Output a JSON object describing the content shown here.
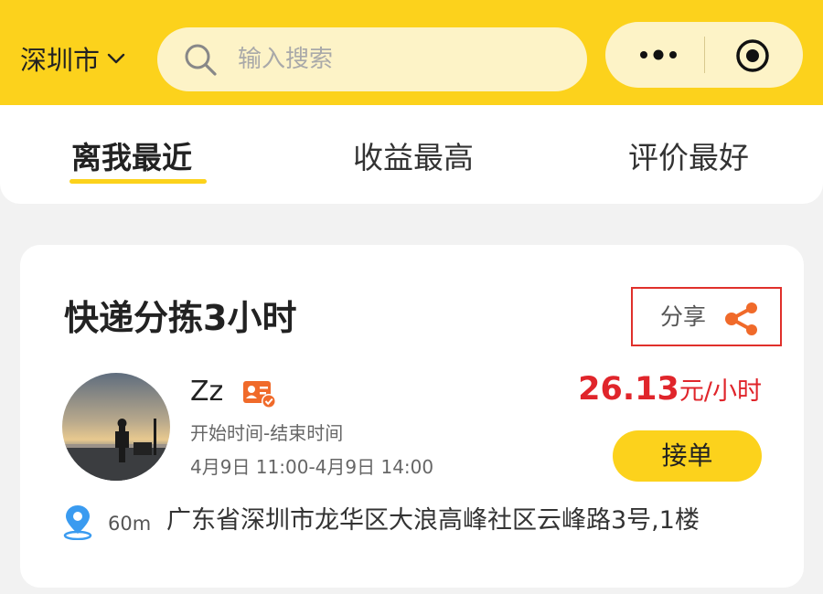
{
  "header": {
    "city": "深圳市",
    "search_placeholder": "输入搜索",
    "accent_color": "#fcd21c"
  },
  "tabs": [
    {
      "label": "离我最近",
      "active": true
    },
    {
      "label": "收益最高",
      "active": false
    },
    {
      "label": "评价最好",
      "active": false
    }
  ],
  "job": {
    "title": "快递分拣3小时",
    "share_label": "分享",
    "user_name": "Zz",
    "time_label": "开始时间-结束时间",
    "time_value": "4月9日 11:00-4月9日 14:00",
    "price": "26.13",
    "price_currency": "元",
    "price_unit": "/小时",
    "accept_label": "接单",
    "distance": "60m",
    "address": "广东省深圳市龙华区大浪高峰社区云峰路3号,1楼"
  },
  "icons": {
    "city_dropdown": "chevron-down-icon",
    "search": "search-icon",
    "more": "more-dots-icon",
    "target": "target-icon",
    "share": "share-icon",
    "verify": "verified-id-icon",
    "location": "location-pin-icon"
  }
}
